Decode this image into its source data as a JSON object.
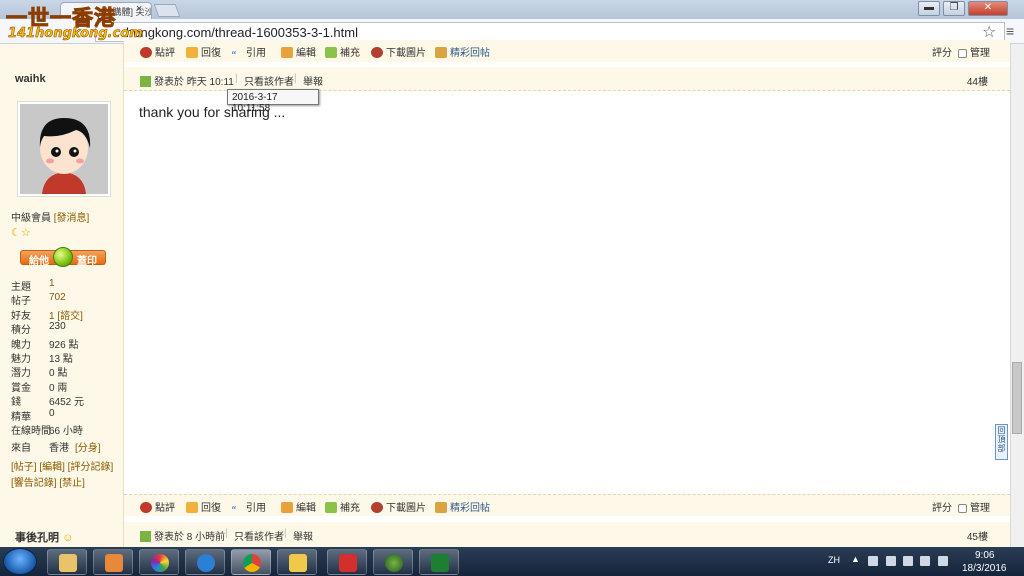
{
  "browser": {
    "tab_title": "[代購體] 尖沙咀…",
    "tab_close": "×",
    "url": "141hongkong.com/thread-1600353-3-1.html",
    "url_shown": "hongkong.com/thread-1600353-3-1.html",
    "win_min": "▬",
    "win_max": "❐",
    "win_close": "✕"
  },
  "site_logo": {
    "zh": "一世一香港",
    "en": "141hongkong.com"
  },
  "top_actions": {
    "rate": "點評",
    "reply": "回復",
    "quote": "引用",
    "edit": "編輯",
    "supplement": "補充",
    "download_images": "下載圖片",
    "featured_reply": "精彩回帖",
    "score": "評分",
    "manage": "管理"
  },
  "post": {
    "username": "waihk",
    "posted_label": "發表於 昨天 10:11",
    "only_author": "只看該作者",
    "report": "舉報",
    "floor": "44樓",
    "tooltip": "2016-3-17 10:11:58",
    "content": "thank you for sharing ..."
  },
  "profile": {
    "rank": "中級會員",
    "send_msg": "[發消息]",
    "give": "給他",
    "stamp": "蓋印",
    "stats": [
      {
        "label": "主題",
        "value": "1"
      },
      {
        "label": "帖子",
        "value": "702"
      },
      {
        "label": "好友",
        "value": "1 [諮交]"
      },
      {
        "label": "積分",
        "value": "230"
      },
      {
        "label": "魄力",
        "value": "926 點"
      },
      {
        "label": "魅力",
        "value": "13 點"
      },
      {
        "label": "潛力",
        "value": "0 點"
      },
      {
        "label": "賞金",
        "value": "0 兩"
      },
      {
        "label": "錢",
        "value": "6452 元"
      },
      {
        "label": "精華",
        "value": "0"
      },
      {
        "label": "在線時間",
        "value": "66 小時"
      }
    ],
    "from_label": "來自",
    "from_value": "香港",
    "from_link": "[分身]",
    "links1": "[帖子] [編輯] [評分記錄]",
    "links2": "[響告記錄] [禁止]"
  },
  "bottom_actions": {
    "rate": "點評",
    "reply": "回復",
    "quote": "引用",
    "edit": "編輯",
    "supplement": "補充",
    "download_images": "下載圖片",
    "featured_reply": "精彩回帖",
    "score": "評分",
    "manage": "管理"
  },
  "next_post": {
    "username": "事後孔明",
    "posted_label": "發表於 8 小時前",
    "only_author": "只看該作者",
    "report": "舉報",
    "floor": "45樓"
  },
  "back_to_top": "回頂部",
  "taskbar": {
    "lang": "ZH",
    "time": "9:06",
    "date": "18/3/2016"
  }
}
